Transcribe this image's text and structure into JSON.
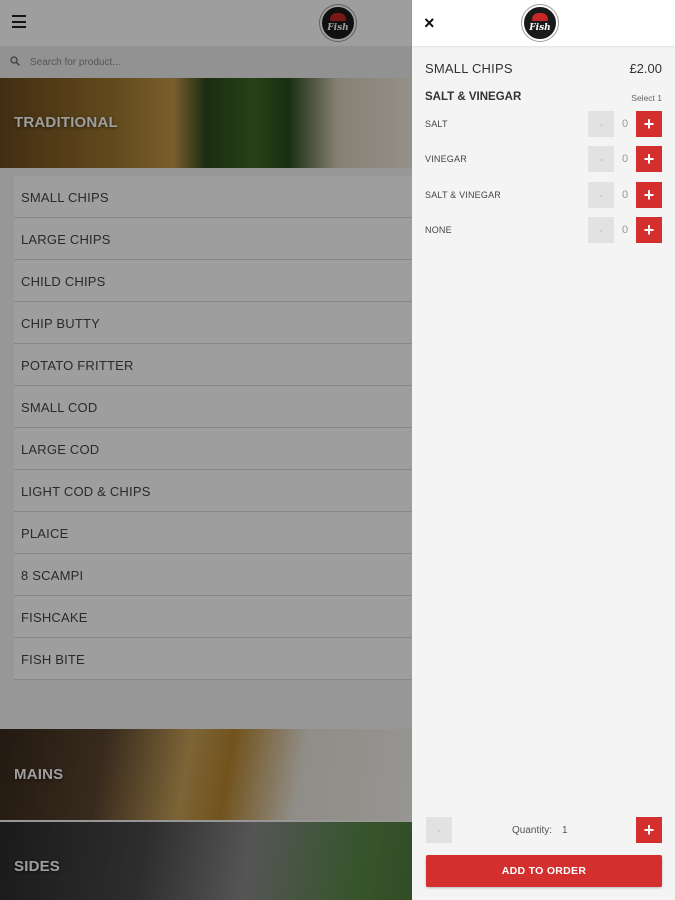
{
  "menu": {
    "logo_text": "Fish",
    "search": {
      "placeholder": "Search for product..."
    },
    "categories": [
      {
        "title": "TRADITIONAL"
      },
      {
        "title": "MAINS"
      },
      {
        "title": "SIDES"
      }
    ],
    "items": [
      "SMALL CHIPS",
      "LARGE CHIPS",
      "CHILD CHIPS",
      "CHIP BUTTY",
      "POTATO FRITTER",
      "SMALL COD",
      "LARGE COD",
      "LIGHT COD & CHIPS",
      "PLAICE",
      "8 SCAMPI",
      "FISHCAKE",
      "FISH BITE"
    ]
  },
  "panel": {
    "close_symbol": "×",
    "logo_text": "Fish",
    "product": {
      "name": "SMALL CHIPS",
      "price": "£2.00"
    },
    "group": {
      "title": "SALT & VINEGAR",
      "hint": "Select 1"
    },
    "options": [
      {
        "label": "SALT",
        "count": "0"
      },
      {
        "label": "VINEGAR",
        "count": "0"
      },
      {
        "label": "SALT & VINEGAR",
        "count": "0"
      },
      {
        "label": "NONE",
        "count": "0"
      }
    ],
    "minus_symbol": "-",
    "plus_symbol": "+",
    "quantity": {
      "label": "Quantity:",
      "value": "1"
    },
    "add_button": "ADD TO ORDER"
  },
  "colors": {
    "accent": "#d32f2f",
    "background": "#f4f4f4"
  },
  "icons": [
    "hamburger-icon",
    "search-icon",
    "close-icon",
    "logo"
  ]
}
